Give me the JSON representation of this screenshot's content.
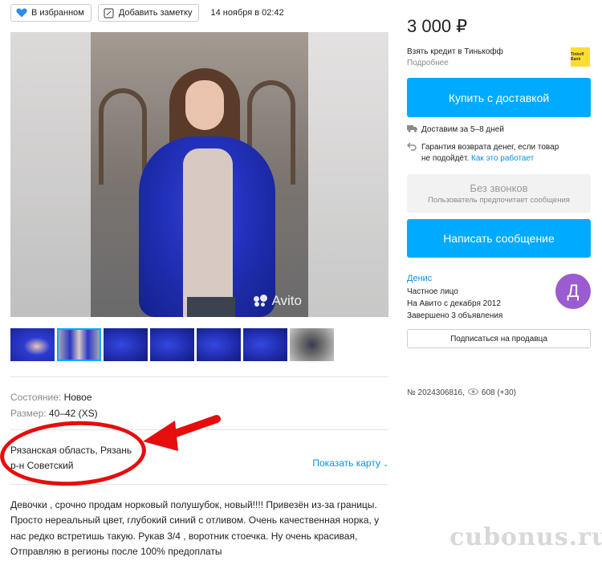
{
  "toolbar": {
    "favorite_label": "В избранном",
    "note_label": "Добавить заметку",
    "date": "14 ноября в 02:42"
  },
  "listing": {
    "image_watermark": "Avito",
    "params": [
      {
        "label": "Состояние:",
        "value": "Новое"
      },
      {
        "label": "Размер:",
        "value": "40–42 (XS)"
      }
    ],
    "address_line1": "Рязанская область, Рязань",
    "address_line2": "р-н Советский",
    "show_map": "Показать карту",
    "description": "Девочки , срочно продам норковый полушубок, новый!!!! Привезён из-за границы. Просто нереальный цвет, глубокий синий с отливом. Очень качественная норка, у нас редко встретишь такую. Рукав 3/4 , воротник стоечка. Ну очень красивая, Отправляю в регионы после 100% предоплаты"
  },
  "sidebar": {
    "price": "3 000 ₽",
    "credit_title": "Взять кредит в Тинькофф",
    "credit_more": "Подробнее",
    "bank_logo_text": "Tinkoff Bank",
    "buy_button": "Купить с доставкой",
    "delivery": "Доставим за 5–8 дней",
    "guarantee_line1": "Гарантия возврата денег, если товар",
    "guarantee_line2": "не подойдёт.",
    "guarantee_link": "Как это работает",
    "no_calls_title": "Без звонков",
    "no_calls_sub": "Пользователь предпочитает сообщения",
    "message_button": "Написать сообщение",
    "seller_name": "Денис",
    "seller_type": "Частное лицо",
    "seller_since": "На Авито с декабря 2012",
    "seller_completed": "Завершено 3 объявления",
    "avatar_letter": "Д",
    "subscribe_button": "Подписаться на продавца",
    "ad_number": "№ 2024306816,",
    "views": "608 (+30)"
  },
  "site_watermark": "cubonus.ru",
  "colors": {
    "accent": "#00aaff",
    "link": "#0a8fe0",
    "annotation": "#e60d0d",
    "avatar": "#9a5cd0"
  }
}
